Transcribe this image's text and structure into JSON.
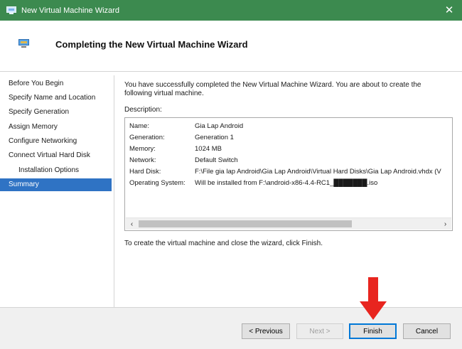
{
  "window": {
    "title": "New Virtual Machine Wizard",
    "close_glyph": "✕"
  },
  "header": {
    "title": "Completing the New Virtual Machine Wizard"
  },
  "nav": {
    "items": [
      {
        "label": "Before You Begin"
      },
      {
        "label": "Specify Name and Location"
      },
      {
        "label": "Specify Generation"
      },
      {
        "label": "Assign Memory"
      },
      {
        "label": "Configure Networking"
      },
      {
        "label": "Connect Virtual Hard Disk"
      },
      {
        "label": "Installation Options"
      },
      {
        "label": "Summary"
      }
    ]
  },
  "main": {
    "intro": "You have successfully completed the New Virtual Machine Wizard. You are about to create the following virtual machine.",
    "description_label": "Description:",
    "description": [
      {
        "key": "Name:",
        "value": "Gia Lap Android"
      },
      {
        "key": "Generation:",
        "value": "Generation 1"
      },
      {
        "key": "Memory:",
        "value": "1024 MB"
      },
      {
        "key": "Network:",
        "value": "Default Switch"
      },
      {
        "key": "Hard Disk:",
        "value": "F:\\File gia lap Android\\Gia Lap Android\\Virtual Hard Disks\\Gia Lap Android.vhdx (V"
      },
      {
        "key": "Operating System:",
        "value": "Will be installed from F:\\android-x86-4.4-RC1_███████.iso"
      }
    ],
    "final_note": "To create the virtual machine and close the wizard, click Finish."
  },
  "buttons": {
    "previous": "< Previous",
    "next": "Next >",
    "finish": "Finish",
    "cancel": "Cancel"
  },
  "colors": {
    "titlebar": "#3c8a4f",
    "nav_selected": "#2f73c4",
    "annotation_arrow": "#e8251f"
  },
  "icons": {
    "titlebar": "vm-monitor-icon",
    "header": "vm-monitor-icon",
    "scroll_left": "‹",
    "scroll_right": "›"
  }
}
